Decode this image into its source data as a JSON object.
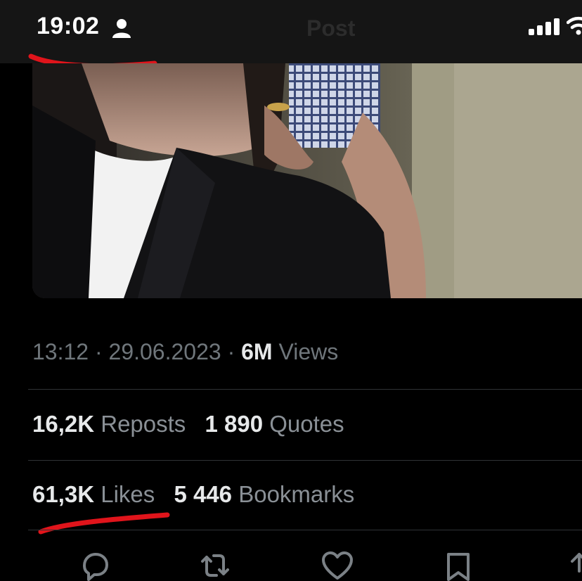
{
  "status_bar": {
    "time": "19:02",
    "person_icon": "person-icon",
    "nav_title": "Post",
    "signal_icon": "cellular-signal-icon",
    "wifi_icon": "wifi-icon"
  },
  "annotation": {
    "color": "#e0141b"
  },
  "tweet": {
    "time": "13:12",
    "separator": "·",
    "date": "29.06.2023",
    "views_count": "6M",
    "views_label": "Views",
    "reposts_count": "16,2K",
    "reposts_label": "Reposts",
    "quotes_count": "1 890",
    "quotes_label": "Quotes",
    "likes_count": "61,3K",
    "likes_label": "Likes",
    "bookmarks_count": "5 446",
    "bookmarks_label": "Bookmarks"
  },
  "actions": [
    {
      "name": "reply",
      "icon": "reply-icon"
    },
    {
      "name": "repost",
      "icon": "repost-icon"
    },
    {
      "name": "like",
      "icon": "heart-icon"
    },
    {
      "name": "bookmark",
      "icon": "bookmark-icon"
    },
    {
      "name": "share",
      "icon": "share-icon"
    }
  ],
  "colors": {
    "background": "#000000",
    "text_primary": "#e7e9ea",
    "text_secondary": "#71767b",
    "divider": "#2f3336"
  }
}
